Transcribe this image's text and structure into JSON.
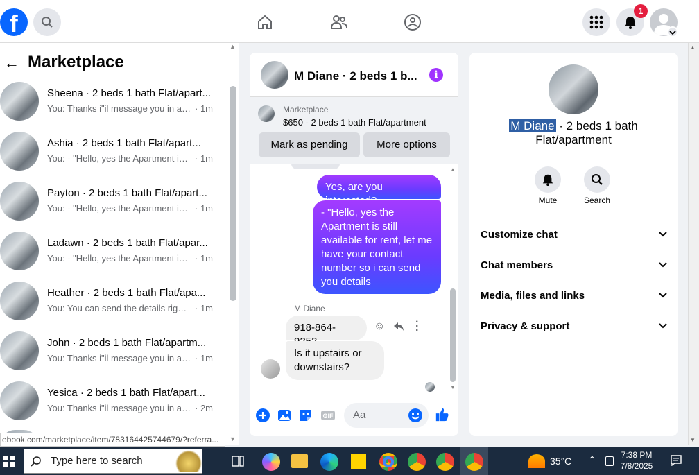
{
  "topbar": {
    "logo_letter": "f",
    "notification_count": "1"
  },
  "left": {
    "title": "Marketplace",
    "conversations": [
      {
        "name": "Sheena · 2 beds 1 bath Flat/apart...",
        "snippet": "You: Thanks i\"il message you in a ...",
        "time": "· 1m"
      },
      {
        "name": "Ashia · 2 beds 1 bath Flat/apart...",
        "snippet": "You: - \"Hello, yes the Apartment is ...",
        "time": "· 1m"
      },
      {
        "name": "Payton · 2 beds 1 bath Flat/apart...",
        "snippet": "You: - \"Hello, yes the Apartment is ...",
        "time": "· 1m"
      },
      {
        "name": "Ladawn · 2 beds 1 bath Flat/apar...",
        "snippet": "You: - \"Hello, yes the Apartment is ...",
        "time": "· 1m"
      },
      {
        "name": "Heather · 2 beds 1 bath Flat/apa...",
        "snippet": "You: You can send the details right...",
        "time": "· 1m"
      },
      {
        "name": "John · 2 beds 1 bath Flat/apartm...",
        "snippet": "You: Thanks i\"il message you in a ...",
        "time": "· 1m"
      },
      {
        "name": "Yesica · 2 beds 1 bath Flat/apart...",
        "snippet": "You: Thanks i\"il message you in a ...",
        "time": "· 2m"
      }
    ],
    "status_url": "ebook.com/marketplace/item/783164425744679/?referra..."
  },
  "chat": {
    "header_title": "M Diane · 2 beds 1 b...",
    "marketplace_label": "Marketplace",
    "listing": "$650 - 2 beds 1 bath Flat/apartment",
    "mark_pending": "Mark as pending",
    "more_options": "More options",
    "msg_out_1": "Yes, are you interested?",
    "msg_out_2": "-       \"Hello, yes the Apartment is still available for rent, let me have your contact number so i can send you details",
    "sender_name": "M Diane",
    "msg_in_1": "918-864-9252",
    "msg_in_2": "Is it upstairs or downstairs?",
    "input_placeholder": "Aa"
  },
  "right": {
    "name_highlight": "M Diane",
    "name_rest": " · 2 beds 1 bath Flat/apartment",
    "mute_label": "Mute",
    "search_label": "Search",
    "sections": [
      "Customize chat",
      "Chat members",
      "Media, files and links",
      "Privacy & support"
    ]
  },
  "taskbar": {
    "search_placeholder": "Type here to search",
    "temperature": "35°C",
    "time": "7:38 PM",
    "date": "7/8/2025"
  },
  "colors": {
    "facebook_blue": "#0866ff",
    "bubble_purple": "#a33bff",
    "notification_red": "#e41e3f"
  }
}
